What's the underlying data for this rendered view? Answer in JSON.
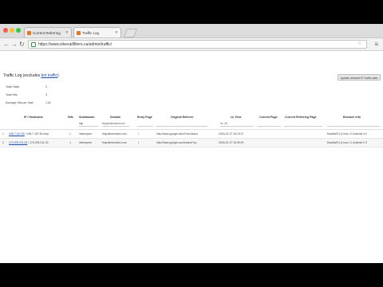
{
  "browser": {
    "tabs": [
      {
        "label": "Current Referring",
        "active": false
      },
      {
        "label": "Traffic Log",
        "active": true
      }
    ],
    "url": "https://www.silverallfilters.ca/admin/traffic/"
  },
  "page": {
    "title_prefix": "Traffic Log (excludes ",
    "title_link": "bot traffic",
    "title_suffix": ")",
    "ip_button": "Update allowed IP traffic data",
    "stats": [
      {
        "label": "Total Visits",
        "value": "2"
      },
      {
        "label": "Total Hits",
        "value": "3"
      },
      {
        "label": "Average Hits per Visit",
        "value": "1.61"
      }
    ]
  },
  "table": {
    "headers": [
      "IP / Hostname",
      "Hits",
      "Subdomain",
      "Domain",
      "Entry Page",
      "Original Referrer",
      "Lk Time",
      "Current Page",
      "Current Referring Page",
      "Browser Info"
    ],
    "filters": {
      "subdomain": "http",
      "domain": "tinyclientrewind.com",
      "time": "01 -25"
    },
    "rows": [
      {
        "num": "1",
        "ip_link": "198.7.167.50",
        "ip_rest": " / 198.7.167.50.nrep",
        "hits": "1",
        "subdomain": "interceptor",
        "domain": "tinyclientrewind.com",
        "entry": "/",
        "referrer": "http://www.google.ca/url?sa=t&sou",
        "time": "2016-01-27 16:15:27",
        "current": "",
        "current_ref": "",
        "browser": "Mozilla/5.0 (Linux; U; Android 4.0"
      },
      {
        "num": "2",
        "ip_link": "173.209.211.32",
        "ip_rest": " / 173.209.211.32",
        "hits": "1",
        "subdomain": "interceptor",
        "domain": "tinyclientrewind.com",
        "entry": "/",
        "referrer": "http://www.google.com/search?q=",
        "time": "2016-01-27 16:05:09",
        "current": "",
        "current_ref": "",
        "browser": "Mozilla/5.0 (Linux; U; Android 2.3"
      }
    ]
  }
}
